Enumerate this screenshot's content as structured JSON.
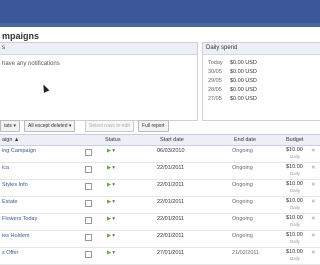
{
  "page": {
    "title": "mpaigns"
  },
  "notifications": {
    "header": "s",
    "message": "have any notifications"
  },
  "daily_spend": {
    "header": "Daily spend",
    "rows": [
      {
        "date": "Today",
        "amount": "$0.00 USD"
      },
      {
        "date": "30/05",
        "amount": "$0.00 USD"
      },
      {
        "date": "29/05",
        "amount": "$0.00 USD"
      },
      {
        "date": "28/05",
        "amount": "$0.00 USD"
      },
      {
        "date": "27/05",
        "amount": "$0.00 USD"
      }
    ]
  },
  "toolbar": {
    "stats_label": "tats ▾",
    "filter_label": "All except deleted ▾",
    "select_label": "Select rows to edit",
    "report_label": "Full report"
  },
  "table": {
    "columns": {
      "name": "aign ▲",
      "status": "Status",
      "start": "Start date",
      "end": "End date",
      "budget": "Budget"
    },
    "rows": [
      {
        "name": "ing Campaign",
        "start": "06/03/2010",
        "end": "Ongoing",
        "budget": "$10.00",
        "period": "Daily"
      },
      {
        "name": "ica",
        "start": "22/01/2011",
        "end": "Ongoing",
        "budget": "$10.00",
        "period": "Daily"
      },
      {
        "name": "Styles Info",
        "start": "22/01/2011",
        "end": "Ongoing",
        "budget": "$10.00",
        "period": "Daily"
      },
      {
        "name": "Estate",
        "start": "22/01/2011",
        "end": "Ongoing",
        "budget": "$10.00",
        "period": "Daily"
      },
      {
        "name": "Flowers Today",
        "start": "22/01/2011",
        "end": "Ongoing",
        "budget": "$10.00",
        "period": "Daily"
      },
      {
        "name": "ies Holdem",
        "start": "22/01/2011",
        "end": "Ongoing",
        "budget": "$10.00",
        "period": "Daily"
      },
      {
        "name": "s Offer",
        "start": "27/01/2011",
        "end": "21/02/2011",
        "budget": "$10.00",
        "period": "Daily"
      }
    ]
  },
  "colors": {
    "brand": "#3b5998",
    "header_bg": "#eceff5",
    "status_active": "#6aa84f"
  },
  "icons": {
    "status": "play-icon",
    "remove": "close-icon"
  }
}
